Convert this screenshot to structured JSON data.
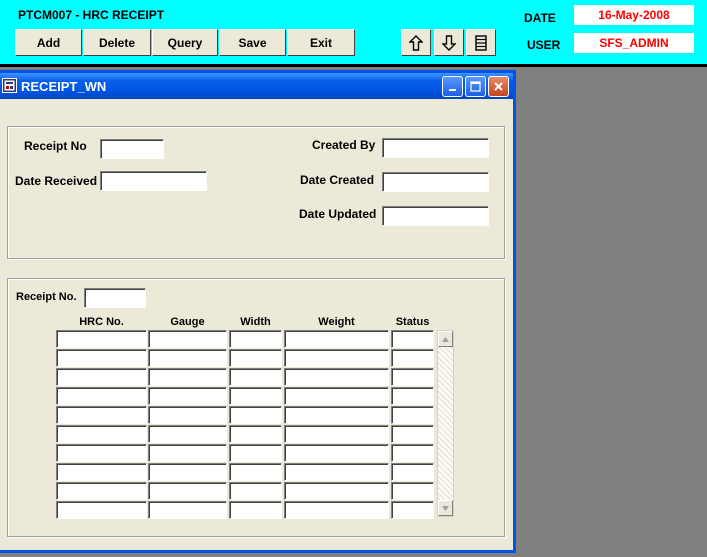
{
  "app": {
    "title": "PTCM007 - HRC RECEIPT"
  },
  "toolbar": {
    "add_label": "Add",
    "delete_label": "Delete",
    "query_label": "Query",
    "save_label": "Save",
    "exit_label": "Exit",
    "nav_icons": [
      "arrow-up-icon",
      "arrow-down-icon",
      "list-icon"
    ]
  },
  "status": {
    "date_label": "DATE",
    "date_value": "16-May-2008",
    "user_label": "USER",
    "user_value": "SFS_ADMIN"
  },
  "window": {
    "title": "RECEIPT_WN"
  },
  "form": {
    "receipt_no_label": "Receipt No",
    "receipt_no_value": "",
    "date_received_label": "Date Received",
    "date_received_value": "",
    "created_by_label": "Created By",
    "created_by_value": "",
    "date_created_label": "Date Created",
    "date_created_value": "",
    "date_updated_label": "Date Updated",
    "date_updated_value": ""
  },
  "detail": {
    "receipt_no_label": "Receipt No.",
    "receipt_no_value": "",
    "columns": [
      "HRC No.",
      "Gauge",
      "Width",
      "Weight",
      "Status"
    ],
    "rows": [
      [
        "",
        "",
        "",
        "",
        ""
      ],
      [
        "",
        "",
        "",
        "",
        ""
      ],
      [
        "",
        "",
        "",
        "",
        ""
      ],
      [
        "",
        "",
        "",
        "",
        ""
      ],
      [
        "",
        "",
        "",
        "",
        ""
      ],
      [
        "",
        "",
        "",
        "",
        ""
      ],
      [
        "",
        "",
        "",
        "",
        ""
      ],
      [
        "",
        "",
        "",
        "",
        ""
      ],
      [
        "",
        "",
        "",
        "",
        ""
      ],
      [
        "",
        "",
        "",
        "",
        ""
      ]
    ]
  },
  "colors": {
    "header_bg": "#00ffff",
    "window_title_bg": "#0054e3",
    "value_text": "#ff0000",
    "form_bg": "#ece9d8",
    "desktop_bg": "#808080"
  }
}
